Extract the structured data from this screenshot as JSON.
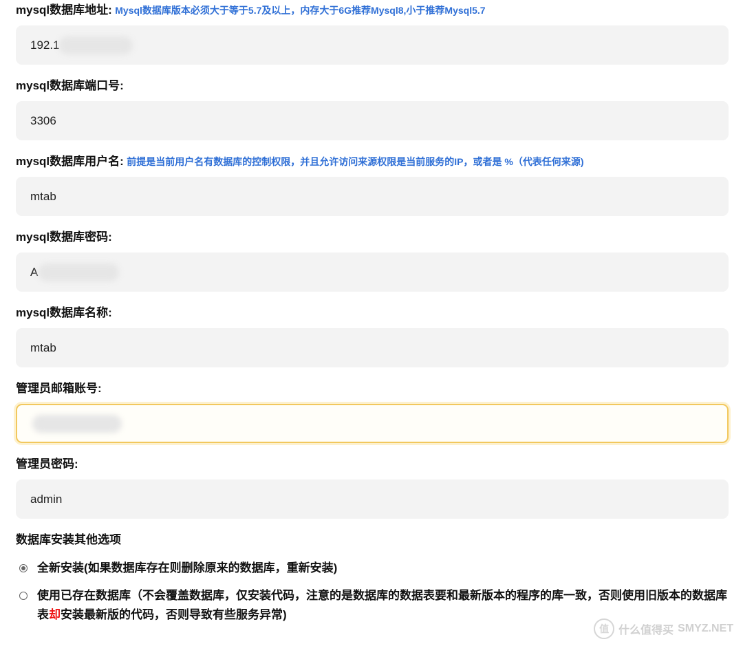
{
  "fields": [
    {
      "label": "mysql数据库地址:",
      "hint": "Mysql数据库版本必须大于等于5.7及以上，内存大于6G推荐Mysql8,小于推荐Mysql5.7",
      "value": "192.1"
    },
    {
      "label": "mysql数据库端口号:",
      "hint": "",
      "value": "3306"
    },
    {
      "label": "mysql数据库用户名:",
      "hint": "前提是当前用户名有数据库的控制权限，并且允许访问来源权限是当前服务的IP，或者是 %（代表任何来源)",
      "value": "mtab"
    },
    {
      "label": "mysql数据库密码:",
      "hint": "",
      "value": "A"
    },
    {
      "label": "mysql数据库名称:",
      "hint": "",
      "value": "mtab"
    },
    {
      "label": "管理员邮箱账号:",
      "hint": "",
      "value": ""
    },
    {
      "label": "管理员密码:",
      "hint": "",
      "value": "admin"
    }
  ],
  "install_options": {
    "title": "数据库安装其他选项",
    "option1": "全新安装(如果数据库存在则删除原来的数据库，重新安装)",
    "option2_part1": "使用已存在数据库（不会覆盖数据库，仅安装代码，注意的是数据库的数据表要和最新版本的程序的库一致，否则使用旧版本的数据库表",
    "option2_red": "却",
    "option2_part2": "安装最新版的代码，否则导致有些服务异常)",
    "selected": "option1"
  },
  "watermark": {
    "badge": "值",
    "text": "什么值得买",
    "site": "SMYZ.NET"
  },
  "colors": {
    "hint": "#2f6fd6",
    "input_bg": "#f3f3f3",
    "focus_border": "#f2c85e",
    "warning_red": "#ee1111"
  }
}
